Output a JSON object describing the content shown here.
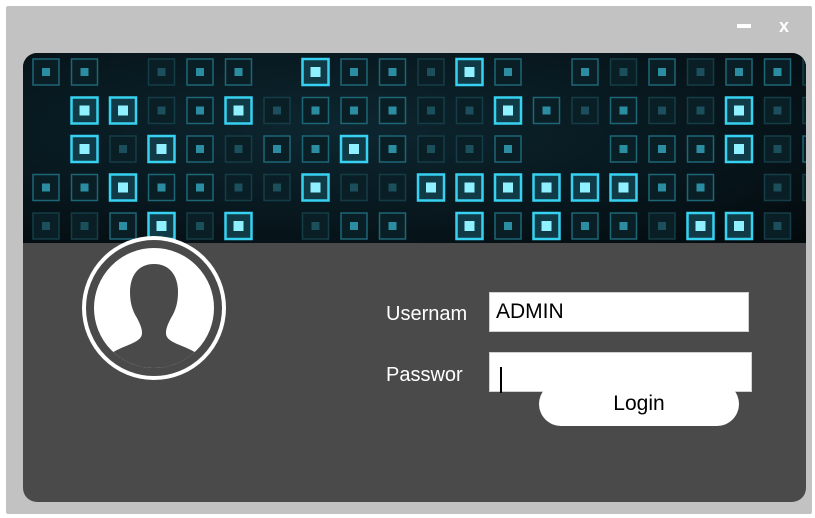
{
  "window": {
    "controls": {
      "minimize_icon": "minimize-icon",
      "close_label": "x"
    }
  },
  "banner": {
    "icon": "circuit-grid",
    "accent": "#37d2f2"
  },
  "avatar": {
    "icon": "user-silhouette-icon"
  },
  "form": {
    "username_label": "Usernam",
    "username_value": "ADMIN",
    "password_label": "Passwor",
    "password_value": "",
    "login_label": "Login"
  },
  "colors": {
    "frame": "#c2c2c2",
    "panel": "#4a4a4a",
    "accent": "#37d2f2"
  }
}
